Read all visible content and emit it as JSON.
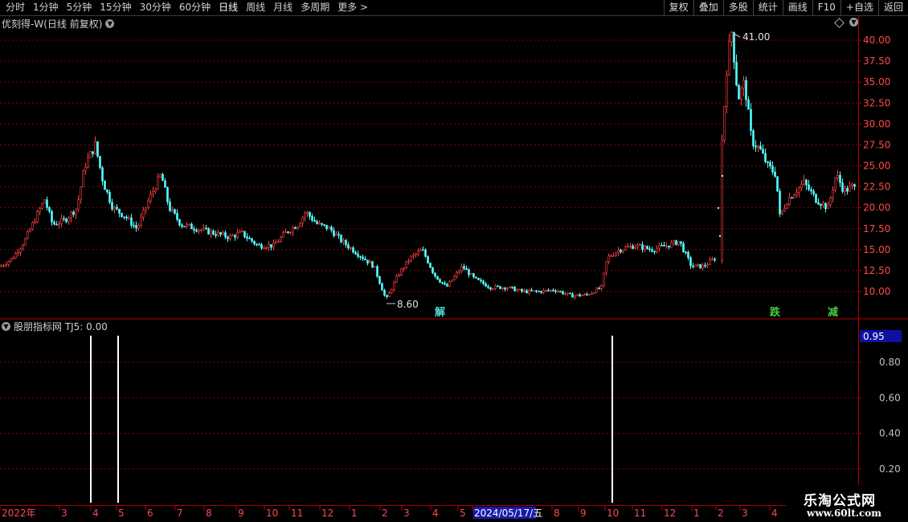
{
  "toolbar": {
    "periods": [
      "分时",
      "1分钟",
      "5分钟",
      "15分钟",
      "30分钟",
      "60分钟",
      "日线",
      "周线",
      "月线",
      "多周期",
      "更多 >"
    ],
    "active_period": "日线",
    "right_buttons": [
      "复权",
      "叠加",
      "多股",
      "统计",
      "画线",
      "F10",
      "+自选",
      "返回"
    ]
  },
  "main_chart": {
    "title": "优刻得-W(日线 前复权)",
    "high_label": "41.00",
    "low_label": "8.60",
    "y_ticks": [
      "40.00",
      "37.50",
      "35.00",
      "32.50",
      "30.00",
      "27.50",
      "25.00",
      "22.50",
      "20.00",
      "17.50",
      "15.00",
      "12.50",
      "10.00"
    ],
    "signals": [
      {
        "text": "解",
        "color": "#4fe0e0"
      },
      {
        "text": "跌",
        "color": "#44d040"
      },
      {
        "text": "减",
        "color": "#44d040"
      }
    ],
    "colors": {
      "up": "#ff4040",
      "down": "#55ffff",
      "grid": "#8b0000",
      "axis": "#b00000"
    }
  },
  "indicator": {
    "title": "股朋指标网 TJ5: 0.00",
    "value_box": "0.95",
    "y_ticks": [
      "0.80",
      "0.60",
      "0.40",
      "0.20"
    ]
  },
  "x_axis": {
    "labels": [
      "2022年",
      "3",
      "4",
      "5",
      "6",
      "7",
      "8",
      "9",
      "10",
      "11",
      "12",
      "1",
      "2",
      "3",
      "4",
      "5",
      "2024/05/17/五",
      "8",
      "9",
      "10",
      "11",
      "12",
      "1",
      "2",
      "3",
      "4"
    ],
    "highlighted": "2024/05/17/五"
  },
  "watermark": {
    "line1": "乐淘公式网",
    "line2": "www.60lt.com"
  }
}
